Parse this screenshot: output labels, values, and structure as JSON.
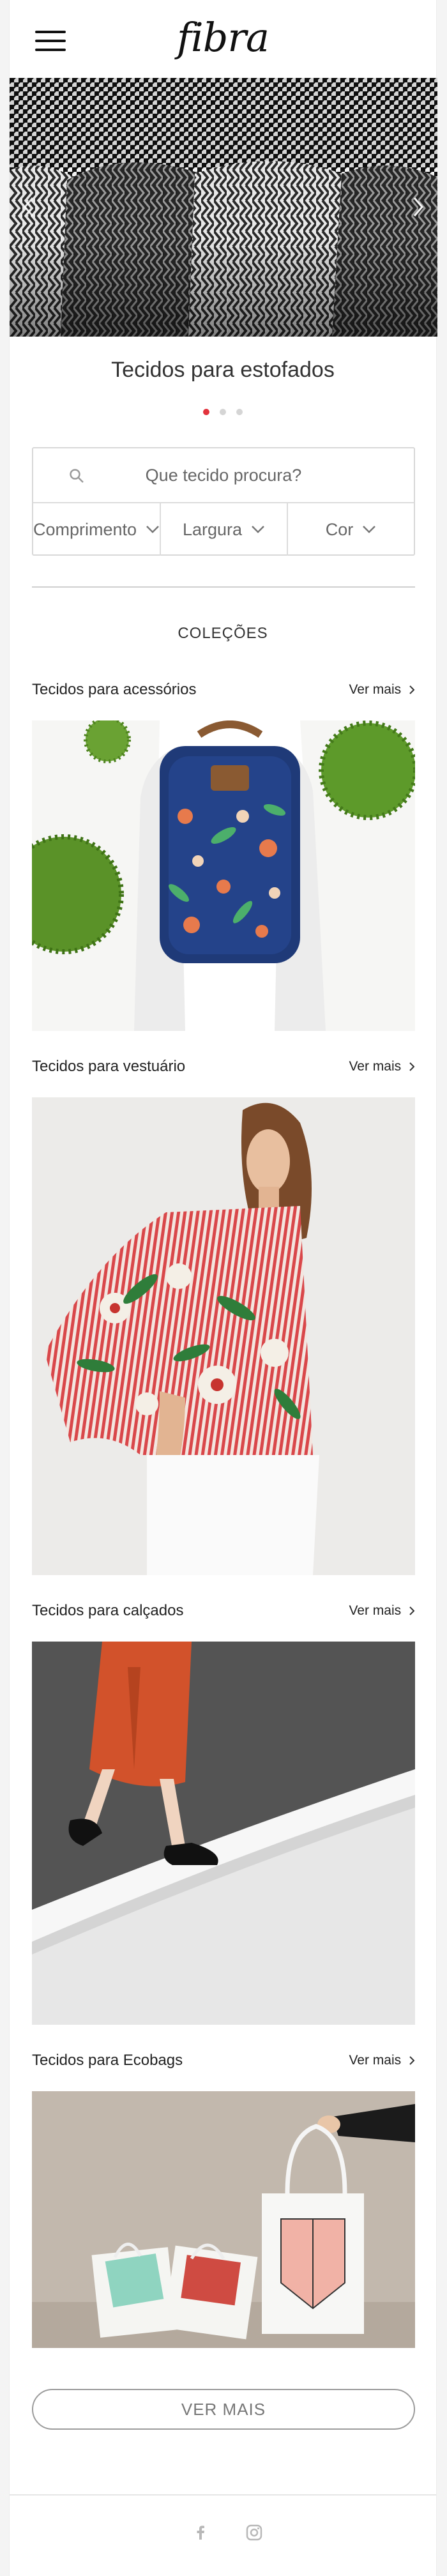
{
  "header": {
    "logo": "fibra",
    "menu_icon": "hamburger-icon"
  },
  "hero": {
    "caption": "Tecidos para estofados",
    "slides": 3,
    "active_slide": 1,
    "prev_icon": "chevron-left-icon",
    "next_icon": "chevron-right-icon"
  },
  "search": {
    "placeholder": "Que tecido procura?",
    "icon": "search-icon",
    "filters": [
      {
        "label": "Comprimento"
      },
      {
        "label": "Largura"
      },
      {
        "label": "Cor"
      }
    ]
  },
  "collections": {
    "title": "COLEÇÕES",
    "more_label": "Ver mais",
    "items": [
      {
        "title": "Tecidos para acessórios"
      },
      {
        "title": "Tecidos para vestuário"
      },
      {
        "title": "Tecidos para calçados"
      },
      {
        "title": "Tecidos para Ecobags"
      }
    ]
  },
  "footer": {
    "more_button": "VER MAIS",
    "social": [
      "facebook-icon",
      "instagram-icon"
    ]
  },
  "colors": {
    "accent": "#e2333d",
    "border": "#d8d8d8"
  }
}
